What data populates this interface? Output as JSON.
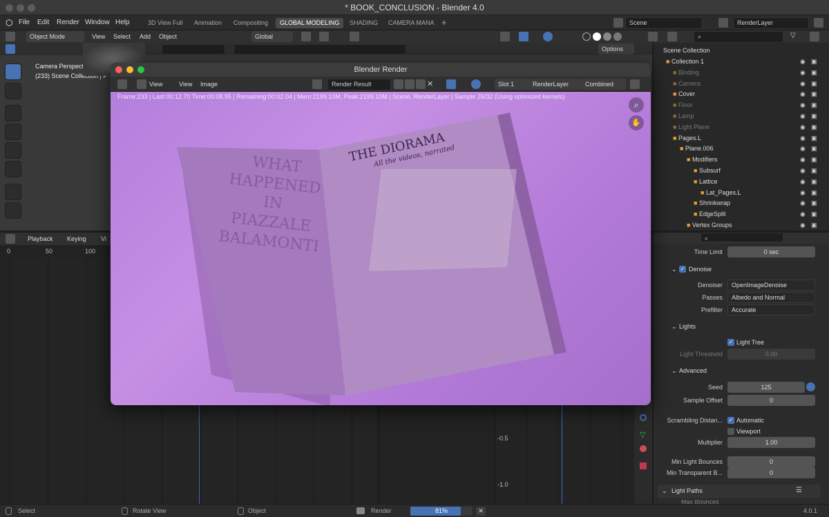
{
  "window": {
    "title": "* BOOK_CONCLUSION - Blender 4.0"
  },
  "menu": [
    "File",
    "Edit",
    "Render",
    "Window",
    "Help"
  ],
  "workspaces": [
    {
      "label": "3D View Full",
      "active": false
    },
    {
      "label": "Animation",
      "active": false
    },
    {
      "label": "Compositing",
      "active": false
    },
    {
      "label": "GLOBAL MODELING",
      "active": true
    },
    {
      "label": "SHADING",
      "active": false
    },
    {
      "label": "CAMERA MANA",
      "active": false
    }
  ],
  "top_right": {
    "scene": "Scene",
    "view_layer": "RenderLayer"
  },
  "viewport": {
    "mode": "Object Mode",
    "view": "View",
    "select": "Select",
    "add": "Add",
    "object": "Object",
    "orientation": "Global",
    "options": "Options",
    "overlay_line1": "Camera Perspective",
    "overlay_line2": "(233) Scene Collection | P"
  },
  "timeline": {
    "playback": "Playback",
    "keying": "Keying",
    "view": "Vi",
    "frames": [
      "0",
      "50",
      "100"
    ],
    "values": [
      "-0.5",
      "-1.0"
    ]
  },
  "render_window": {
    "title": "Blender Render",
    "view": "View",
    "view2": "View",
    "image": "Image",
    "render_result": "Render Result",
    "slot": "Slot 1",
    "layer": "RenderLayer",
    "pass": "Combined",
    "info": "Frame:233 | Last:00:12.70 Time:00:08.95 | Remaining:00:02.04 | Mem:2199.10M, Peak:2199.10M | Scene, RenderLayer | Sample 26/32 (Using optimized kernels)",
    "left_page_title": [
      "WHAT",
      "HAPPENED",
      "IN PIAZZALE",
      "BALAMONTI"
    ],
    "right_page_title": "THE DIORAMA",
    "right_page_subtitle": "All the videos, narrated"
  },
  "outliner": {
    "header": "Scene Collection",
    "rows": [
      {
        "label": "Collection 1",
        "indent": 1,
        "dim": false
      },
      {
        "label": "Binding",
        "indent": 2,
        "dim": true
      },
      {
        "label": "Camera",
        "indent": 2,
        "dim": true
      },
      {
        "label": "Cover",
        "indent": 2,
        "dim": false
      },
      {
        "label": "Floor",
        "indent": 2,
        "dim": true
      },
      {
        "label": "Lamp",
        "indent": 2,
        "dim": true
      },
      {
        "label": "Light Plane",
        "indent": 2,
        "dim": true
      },
      {
        "label": "Pages.L",
        "indent": 2,
        "dim": false
      },
      {
        "label": "Plane.006",
        "indent": 3,
        "dim": false
      },
      {
        "label": "Modifiers",
        "indent": 4,
        "dim": false
      },
      {
        "label": "Subsurf",
        "indent": 5,
        "dim": false
      },
      {
        "label": "Lattice",
        "indent": 5,
        "dim": false
      },
      {
        "label": "Lat_Pages.L",
        "indent": 6,
        "dim": false
      },
      {
        "label": "Shrinkwrap",
        "indent": 5,
        "dim": false
      },
      {
        "label": "EdgeSplit",
        "indent": 5,
        "dim": false
      },
      {
        "label": "Vertex Groups",
        "indent": 4,
        "dim": false
      }
    ]
  },
  "properties": {
    "time_limit_label": "Time Limit",
    "time_limit": "0 sec",
    "denoise": "Denoise",
    "denoiser_label": "Denoiser",
    "denoiser": "OpenImageDenoise",
    "passes_label": "Passes",
    "passes": "Albedo and Normal",
    "prefilter_label": "Prefilter",
    "prefilter": "Accurate",
    "lights": "Lights",
    "light_tree": "Light Tree",
    "light_threshold_label": "Light Threshold",
    "light_threshold": "0.00",
    "advanced": "Advanced",
    "seed_label": "Seed",
    "seed": "125",
    "sample_offset_label": "Sample Offset",
    "sample_offset": "0",
    "scrambling_label": "Scrambling Distan...",
    "automatic": "Automatic",
    "viewport": "Viewport",
    "multiplier_label": "Multiplier",
    "multiplier": "1.00",
    "min_light_label": "Min Light Bounces",
    "min_light": "0",
    "min_transparent_label": "Min Transparent B...",
    "min_transparent": "0",
    "light_paths": "Light Paths",
    "max_bounces": "Max Bounces"
  },
  "statusbar": {
    "select": "Select",
    "rotate": "Rotate View",
    "object": "Object",
    "render": "Render",
    "progress": "81%",
    "progress_value": 0.81,
    "version": "4.0.1"
  }
}
